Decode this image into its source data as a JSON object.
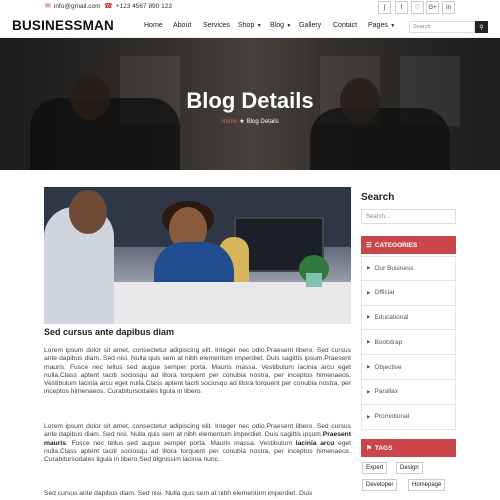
{
  "topbar": {
    "email": "info@gmail.com",
    "phone": "+123 4567 890 123",
    "social": [
      {
        "icon": "rss-icon",
        "glyph": "ʃ"
      },
      {
        "icon": "facebook-icon",
        "glyph": "f"
      },
      {
        "icon": "twitter-icon",
        "glyph": "♡"
      },
      {
        "icon": "google-plus-icon",
        "glyph": "G+"
      },
      {
        "icon": "linkedin-icon",
        "glyph": "in"
      }
    ]
  },
  "nav": {
    "logo": "BUSINESSMAN",
    "items": [
      "Home",
      "About",
      "Services",
      "Shop",
      "Blog",
      "Gallery",
      "Contact",
      "Pages"
    ],
    "search_placeholder": "Search"
  },
  "hero": {
    "title": "Blog Details",
    "breadcrumb_home": "Home",
    "breadcrumb_current": "Blog Details"
  },
  "post": {
    "title": "Sed cursus ante dapibus diam",
    "para1": "Lorem ipsum dolor sit amet, consectetur adipiscing elit. Integer nec odio.Praesent libero. Sed cursus ante dapibus diam. Sed nisi. Nulla quis sem at nibh elementum imperdiet. Duis sagittis ipsum.Praesent mauris. Fusce nec tellus sed augue semper porta. Mauris massa. Vestibulum lacinia arcu eget nulla.Class aptent taciti sociosqu ad litora torquent per conubia nostra, per inceptos himenaeos. Vestibulum lacinia arcu eget nulla.Class aptent taciti sociosqu ad litora torquent per conubia nostra, per inceptos himenaeos. Curabitursodales ligula in libero.",
    "para2_a": "Lorem ipsum dolor sit amet, consectetur adipiscing elit. Integer nec odio.Praesent libero. Sed cursus ante dapibus diam. Sed nisi. Nulla quis sem at nibh elementum imperdiet. Duis sagittis ipsum.",
    "para2_bold1": "Praesent mauris",
    "para2_b": ". Fusce nec tellus sed augue semper porta. Mauris massa. Vestibulum ",
    "para2_bold2": "lacinia arcu",
    "para2_c": " eget nulla.Class aptent taciti sociosqu ad litora torquent per conubia nostra, per inceptos himenaeos. Curabitursodales ligula in libero.Sed dignissim lacinia nunc.",
    "para3": "Sed cursus ante dapibus diam. Sed nisi. Nulla quis sem at nibh elementum imperdiet. Duis"
  },
  "sidebar": {
    "search_heading": "Search",
    "search_placeholder": "Search...",
    "categories_heading": "CATEGORIES",
    "categories": [
      "Our Business",
      "Official",
      "Educational",
      "Bootstrap",
      "Objective",
      "Parallax",
      "Promotional"
    ],
    "tags_heading": "TAGS",
    "tags": [
      "Expert",
      "Design",
      "Developer",
      "Homepage"
    ]
  },
  "colors": {
    "accent": "#c9474b",
    "breadcrumb_home": "#e05a47"
  }
}
